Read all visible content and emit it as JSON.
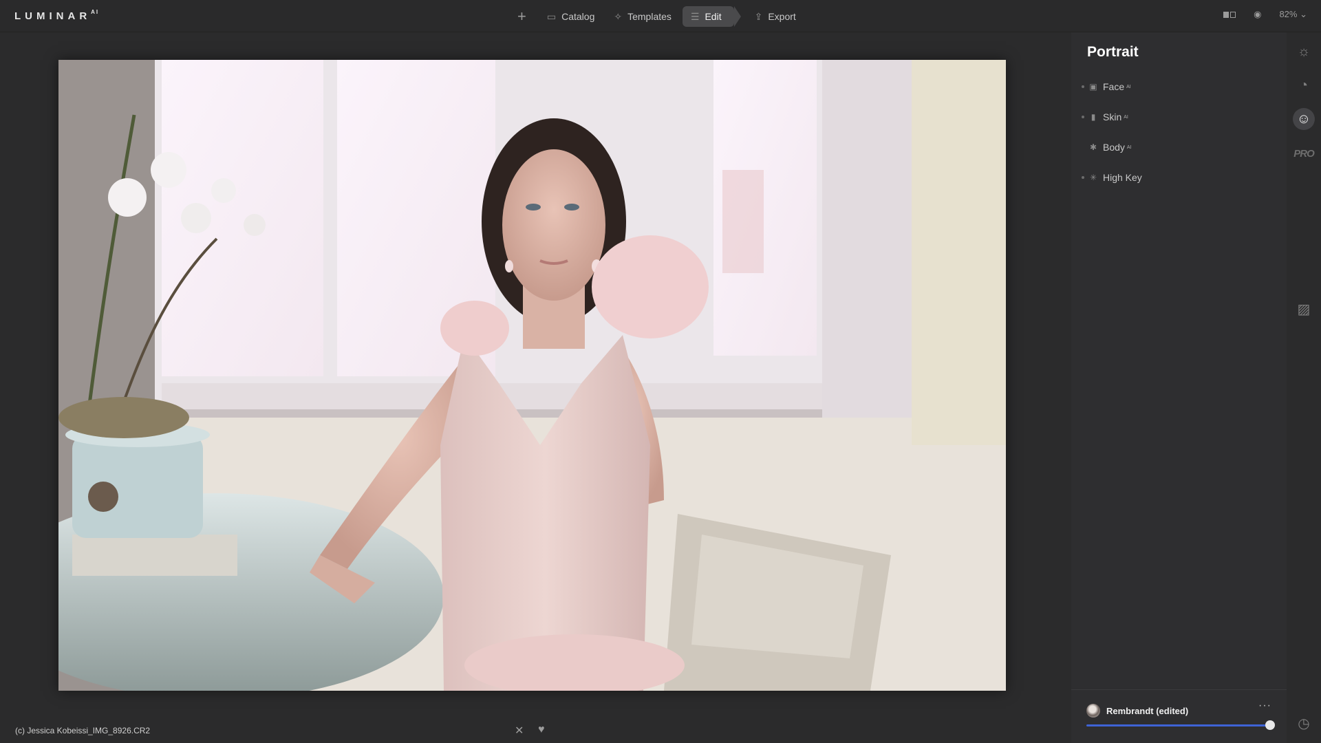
{
  "app": {
    "logo": "LUMINAR",
    "logo_sup": "AI"
  },
  "nav": {
    "add_icon": "plus-icon",
    "items": [
      {
        "label": "Catalog",
        "icon": "folder-icon"
      },
      {
        "label": "Templates",
        "icon": "sparkle-icon"
      },
      {
        "label": "Edit",
        "icon": "sliders-icon",
        "active": true
      },
      {
        "label": "Export",
        "icon": "share-icon"
      }
    ]
  },
  "top_right": {
    "zoom": "82%"
  },
  "photo": {
    "filename": "(c) Jessica Kobeissi_IMG_8926.CR2"
  },
  "panel": {
    "title": "Portrait",
    "tools": [
      {
        "label": "Face",
        "ai": "AI",
        "icon": "face-frame-icon"
      },
      {
        "label": "Skin",
        "ai": "AI",
        "icon": "skin-bottle-icon"
      },
      {
        "label": "Body",
        "ai": "AI",
        "icon": "body-figure-icon"
      },
      {
        "label": "High Key",
        "ai": "",
        "icon": "high-key-icon"
      }
    ],
    "preset": {
      "name": "Rembrandt (edited)",
      "more": "···",
      "amount": 1.0
    }
  },
  "rail": {
    "items": [
      "sun-icon",
      "palette-icon",
      "smile-icon",
      "pro-badge",
      "frame-icon",
      "history-icon"
    ],
    "pro_label": "PRO"
  },
  "colors": {
    "accent": "#3e63d6",
    "panel_bg": "#2e2e30",
    "app_bg": "#2b2b2c"
  }
}
